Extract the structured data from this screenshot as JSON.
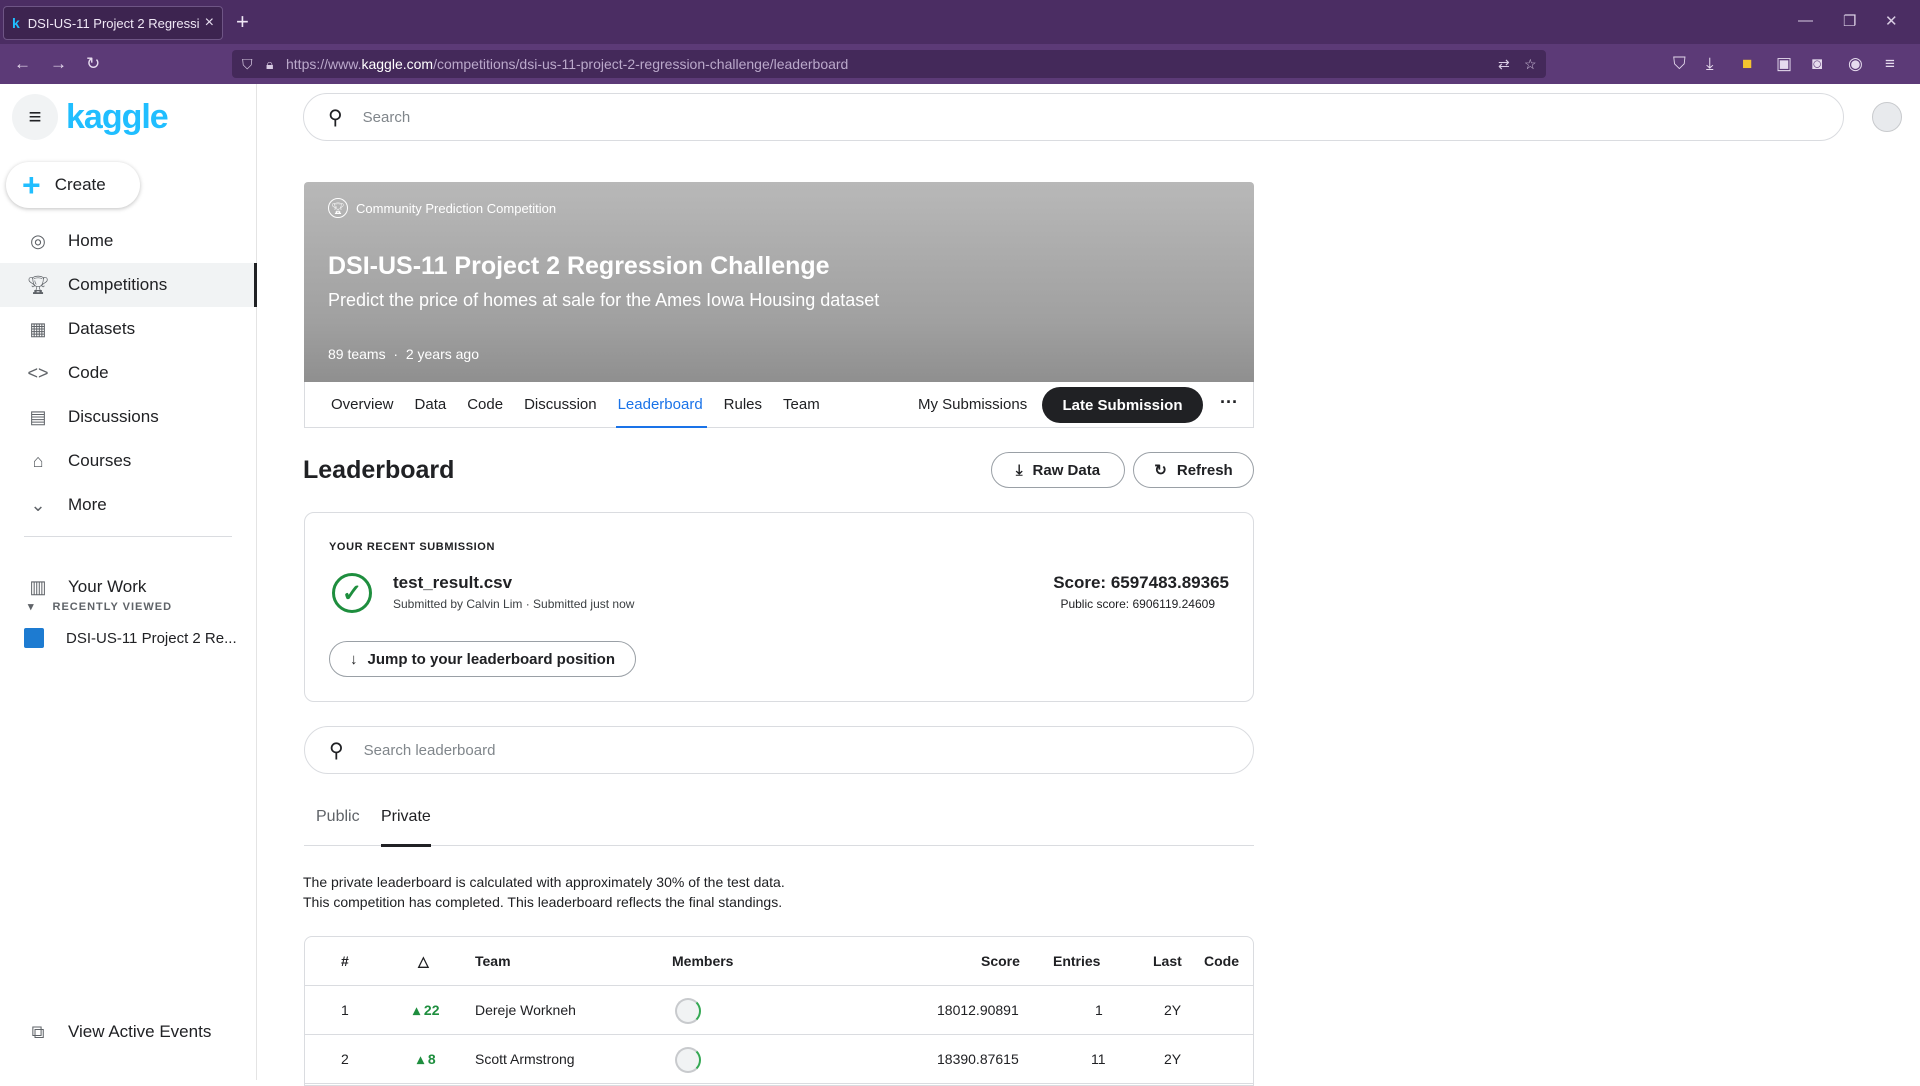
{
  "browser": {
    "tab_title": "DSI-US-11 Project 2 Regression",
    "tab_favicon": "k",
    "url_prefix": "https://www.",
    "url_domain": "kaggle.com",
    "url_path": "/competitions/dsi-us-11-project-2-regression-challenge/leaderboard"
  },
  "sidebar": {
    "logo": "kaggle",
    "create_label": "Create",
    "items": [
      {
        "label": "Home",
        "icon": "compass-icon"
      },
      {
        "label": "Competitions",
        "icon": "trophy-icon"
      },
      {
        "label": "Datasets",
        "icon": "table-icon"
      },
      {
        "label": "Code",
        "icon": "code-icon"
      },
      {
        "label": "Discussions",
        "icon": "comment-icon"
      },
      {
        "label": "Courses",
        "icon": "graduation-cap-icon"
      },
      {
        "label": "More",
        "icon": "chevron-down-icon"
      }
    ],
    "your_work": "Your Work",
    "recently_viewed_label": "RECENTLY VIEWED",
    "recent_item": "DSI-US-11 Project 2 Re...",
    "view_active_events": "View Active Events"
  },
  "search": {
    "placeholder": "Search"
  },
  "competition": {
    "kind": "Community Prediction Competition",
    "title": "DSI-US-11 Project 2 Regression Challenge",
    "subtitle": "Predict the price of homes at sale for the Ames Iowa Housing dataset",
    "teams": "89 teams",
    "age": "2 years ago",
    "tabs": [
      "Overview",
      "Data",
      "Code",
      "Discussion",
      "Leaderboard",
      "Rules",
      "Team"
    ],
    "my_submissions": "My Submissions",
    "late_submission": "Late Submission"
  },
  "leaderboard": {
    "title": "Leaderboard",
    "raw_data": "Raw Data",
    "refresh": "Refresh",
    "recent_label": "YOUR RECENT SUBMISSION",
    "file_name": "test_result.csv",
    "submitted_by": "Submitted by Calvin Lim · Submitted just now",
    "score": "Score: 6597483.89365",
    "public_score": "Public score: 6906119.24609",
    "jump": "Jump to your leaderboard position",
    "search_placeholder": "Search leaderboard",
    "tab_public": "Public",
    "tab_private": "Private",
    "note_line1": "The private leaderboard is calculated with approximately 30% of the test data.",
    "note_line2": "This competition has completed. This leaderboard reflects the final standings.",
    "headers": {
      "rank": "#",
      "delta": "△",
      "team": "Team",
      "members": "Members",
      "score": "Score",
      "entries": "Entries",
      "last": "Last",
      "code": "Code"
    },
    "rows": [
      {
        "rank": "1",
        "delta": "▴ 22",
        "team": "Dereje Workneh",
        "score": "18012.90891",
        "entries": "1",
        "last": "2Y"
      },
      {
        "rank": "2",
        "delta": "▴ 8",
        "team": "Scott Armstrong",
        "score": "18390.87615",
        "entries": "11",
        "last": "2Y"
      }
    ]
  }
}
